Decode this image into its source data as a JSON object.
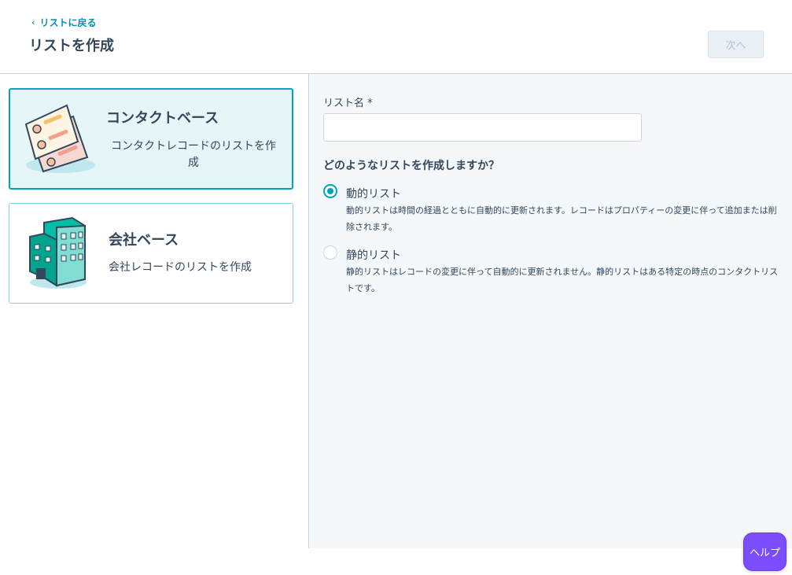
{
  "header": {
    "back_label": "リストに戻る",
    "title": "リストを作成",
    "next_label": "次へ"
  },
  "cards": {
    "contact": {
      "title": "コンタクトベース",
      "description": "コンタクトレコードのリストを作成"
    },
    "company": {
      "title": "会社ベース",
      "description": "会社レコードのリストを作成"
    }
  },
  "form": {
    "list_name_label": "リスト名 *",
    "list_name_value": "",
    "question": "どのようなリストを作成しますか？",
    "options": [
      {
        "label": "動的リスト",
        "description": "動的リストは時間の経過とともに自動的に更新されます。レコードはプロパティーの変更に伴って追加または削除されます。",
        "selected": true
      },
      {
        "label": "静的リスト",
        "description": "静的リストはレコードの変更に伴って自動的に更新されません。静的リストはある特定の時点のコンタクトリストです。",
        "selected": false
      }
    ]
  },
  "help": {
    "label": "ヘルプ"
  },
  "colors": {
    "accent": "#00a4bd",
    "link": "#0091ae",
    "text": "#33475b",
    "help": "#7c4dff"
  }
}
